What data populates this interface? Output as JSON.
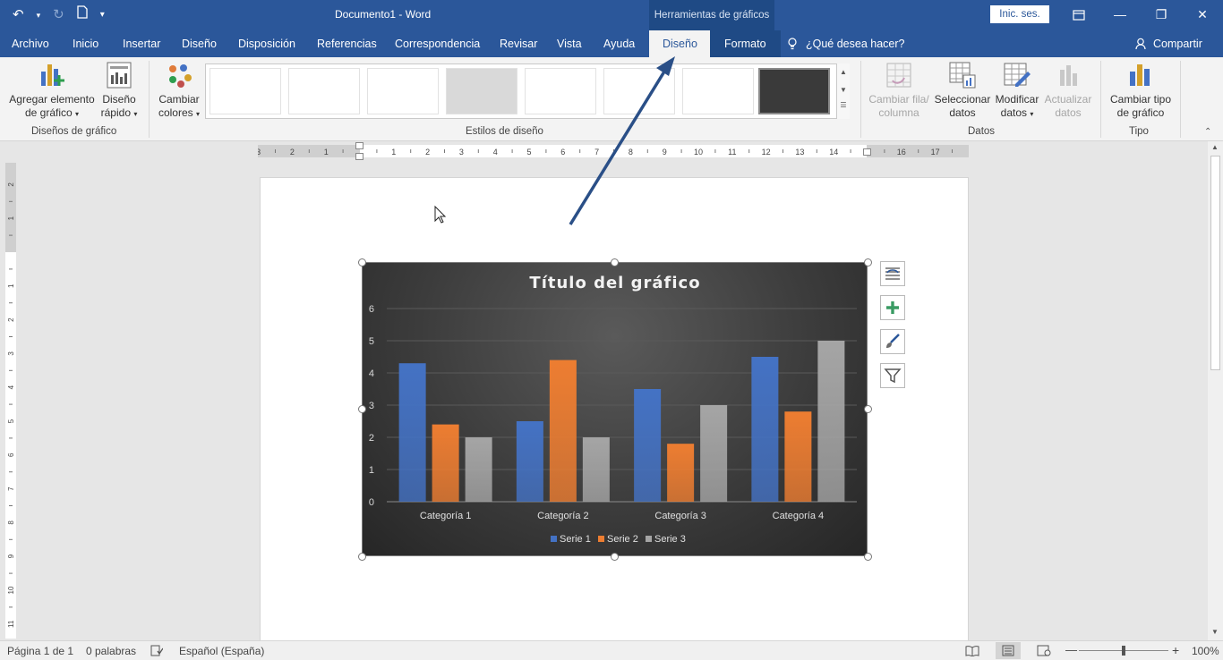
{
  "titlebar": {
    "document_title": "Documento1  -  Word",
    "context_title": "Herramientas de gráficos",
    "signin_label": "Inic. ses."
  },
  "tabs": [
    {
      "label": "Archivo"
    },
    {
      "label": "Inicio"
    },
    {
      "label": "Insertar"
    },
    {
      "label": "Diseño"
    },
    {
      "label": "Disposición"
    },
    {
      "label": "Referencias"
    },
    {
      "label": "Correspondencia"
    },
    {
      "label": "Revisar"
    },
    {
      "label": "Vista"
    },
    {
      "label": "Ayuda"
    },
    {
      "label": "Diseño"
    },
    {
      "label": "Formato"
    }
  ],
  "tellme": {
    "label": "¿Qué desea hacer?"
  },
  "share": {
    "label": "Compartir"
  },
  "ribbon": {
    "add_element": "Agregar elemento",
    "add_element2": "de gráfico",
    "quick_layout": "Diseño",
    "quick_layout2": "rápido",
    "change_colors": "Cambiar",
    "change_colors2": "colores",
    "switch_row": "Cambiar fila/",
    "switch_row2": "columna",
    "select_data": "Seleccionar",
    "select_data2": "datos",
    "edit_data": "Modificar",
    "edit_data2": "datos",
    "refresh_data": "Actualizar",
    "refresh_data2": "datos",
    "change_type": "Cambiar tipo",
    "change_type2": "de gráfico",
    "group_layouts": "Diseños de gráfico",
    "group_styles": "Estilos de diseño",
    "group_data": "Datos",
    "group_type": "Tipo"
  },
  "chart_data": {
    "type": "bar",
    "title": "Título del gráfico",
    "categories": [
      "Categoría 1",
      "Categoría 2",
      "Categoría 3",
      "Categoría 4"
    ],
    "series": [
      {
        "name": "Serie 1",
        "values": [
          4.3,
          2.5,
          3.5,
          4.5
        ],
        "color": "#4472c4"
      },
      {
        "name": "Serie 2",
        "values": [
          2.4,
          4.4,
          1.8,
          2.8
        ],
        "color": "#ed7d31"
      },
      {
        "name": "Serie 3",
        "values": [
          2,
          2,
          3,
          5
        ],
        "color": "#a5a5a5"
      }
    ],
    "yticks": [
      "0",
      "1",
      "2",
      "3",
      "4",
      "5",
      "6"
    ],
    "ylim": [
      0,
      6
    ],
    "grid": true,
    "legend": "bottom"
  },
  "status": {
    "page": "Página 1 de 1",
    "words": "0 palabras",
    "language": "Español (España)",
    "zoom": "100%"
  },
  "ruler": {
    "h_labels": [
      "3",
      "2",
      "1",
      "1",
      "2",
      "3",
      "4",
      "5",
      "6",
      "7",
      "8",
      "9",
      "10",
      "11",
      "12",
      "13",
      "14",
      "16",
      "17"
    ],
    "v_labels": [
      "2",
      "1",
      "1",
      "2",
      "3",
      "4",
      "5",
      "6",
      "7",
      "8",
      "9",
      "10",
      "11"
    ]
  }
}
